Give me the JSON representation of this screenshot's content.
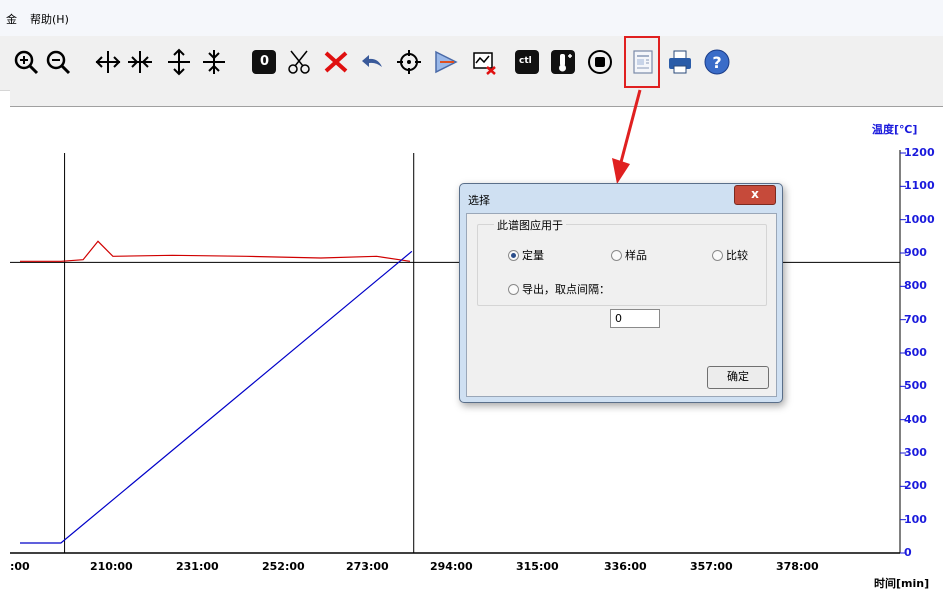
{
  "menu": {
    "item_partial": "金",
    "help": "帮助(H)"
  },
  "toolbar": {
    "icons": [
      "zoom-in",
      "zoom-out",
      "expand-horizontal",
      "compress-horizontal",
      "expand-vertical",
      "compress-vertical",
      "zero",
      "cut",
      "delete",
      "undo",
      "target",
      "marker",
      "screenshot-chart",
      "temp-control",
      "thermometer",
      "stop",
      "report",
      "print",
      "help"
    ],
    "zero_label": "0",
    "ctl_label": "ctl"
  },
  "chart_data": {
    "type": "line",
    "xlabel": "时间[min]",
    "ylabel": "温度[℃]",
    "x_tick_labels": [
      ":00",
      "210:00",
      "231:00",
      "252:00",
      "273:00",
      "294:00",
      "315:00",
      "336:00",
      "357:00",
      "378:00"
    ],
    "y_tick_labels": [
      "1200",
      "1100",
      "1000",
      "900",
      "800",
      "700",
      "600",
      "500",
      "400",
      "300",
      "200",
      "100",
      "0"
    ],
    "ylim": [
      0,
      1200
    ],
    "xlim": [
      189,
      399
    ],
    "series": [
      {
        "color": "#d00000",
        "points": [
          [
            189,
            875
          ],
          [
            200,
            875
          ],
          [
            206,
            880
          ],
          [
            210,
            935
          ],
          [
            214,
            890
          ],
          [
            230,
            893
          ],
          [
            250,
            890
          ],
          [
            270,
            885
          ],
          [
            285,
            890
          ],
          [
            294,
            875
          ]
        ]
      },
      {
        "color": "#0000c8",
        "points": [
          [
            189,
            30
          ],
          [
            200,
            30
          ],
          [
            294.5,
            905
          ]
        ]
      }
    ],
    "horizontal_line_value": 872,
    "vertical_lines_x": [
      201,
      295
    ]
  },
  "dialog": {
    "title": "选择",
    "group_label": "此谱图应用于",
    "radio_quant": "定量",
    "radio_sample": "样品",
    "radio_compare": "比较",
    "radio_export": "导出，取点间隔：",
    "export_interval": "0",
    "ok_label": "确定",
    "close_label": "x"
  },
  "colors": {
    "accent_highlight": "#e02020",
    "axis_blue": "#1a1adc"
  }
}
